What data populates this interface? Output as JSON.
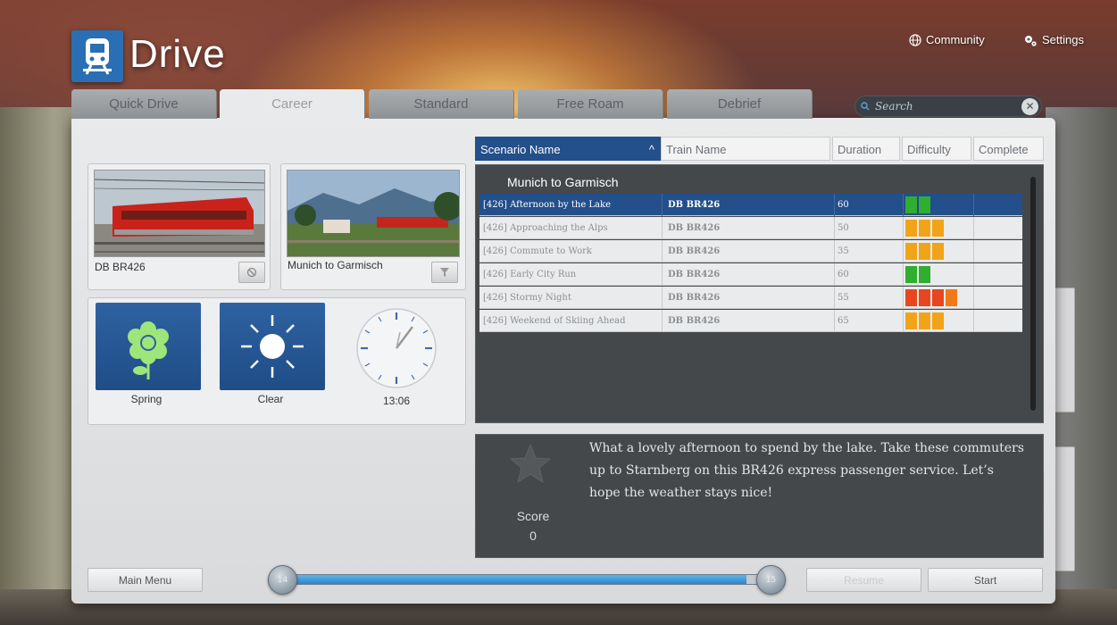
{
  "header": {
    "title": "Drive",
    "community_label": "Community",
    "settings_label": "Settings"
  },
  "tabs": [
    {
      "label": "Quick Drive"
    },
    {
      "label": "Career"
    },
    {
      "label": "Standard"
    },
    {
      "label": "Free Roam"
    },
    {
      "label": "Debrief"
    }
  ],
  "search": {
    "placeholder": "Search"
  },
  "train_card": {
    "label": "DB BR426"
  },
  "route_card": {
    "label": "Munich to Garmisch"
  },
  "conditions": {
    "season": "Spring",
    "weather": "Clear",
    "time": "13:06"
  },
  "table": {
    "columns": [
      "Scenario Name",
      "Train Name",
      "Duration",
      "Difficulty",
      "Complete"
    ],
    "group_title": "Munich to Garmisch",
    "rows": [
      {
        "name": "[426] Afternoon by the Lake",
        "train": "DB BR426",
        "duration": "60",
        "difficulty": 2,
        "difficulty_color": "#2fae2f"
      },
      {
        "name": "[426] Approaching the Alps",
        "train": "DB BR426",
        "duration": "50",
        "difficulty": 3,
        "difficulty_color": "#f2a418"
      },
      {
        "name": "[426] Commute to Work",
        "train": "DB BR426",
        "duration": "35",
        "difficulty": 3,
        "difficulty_color": "#f2a418"
      },
      {
        "name": "[426] Early City Run",
        "train": "DB BR426",
        "duration": "60",
        "difficulty": 2,
        "difficulty_color": "#2fae2f"
      },
      {
        "name": "[426] Stormy Night",
        "train": "DB BR426",
        "duration": "55",
        "difficulty": 4,
        "difficulty_color": "#e8461e"
      },
      {
        "name": "[426] Weekend of Skiing Ahead",
        "train": "DB BR426",
        "duration": "65",
        "difficulty": 3,
        "difficulty_color": "#f2a418"
      }
    ]
  },
  "description": {
    "text": "What a lovely afternoon to spend by the lake. Take these commuters up to Starnberg on this BR426 express passenger service. Let’s hope the weather stays nice!",
    "score_label": "Score",
    "score_value": "0"
  },
  "footer": {
    "main_menu": "Main Menu",
    "resume": "Resume",
    "start": "Start",
    "slider_min": "14",
    "slider_max": "15",
    "slider_progress": 0.96
  },
  "colors": {
    "accent": "#234f8a",
    "tile_blue": "#2a5d9f"
  }
}
